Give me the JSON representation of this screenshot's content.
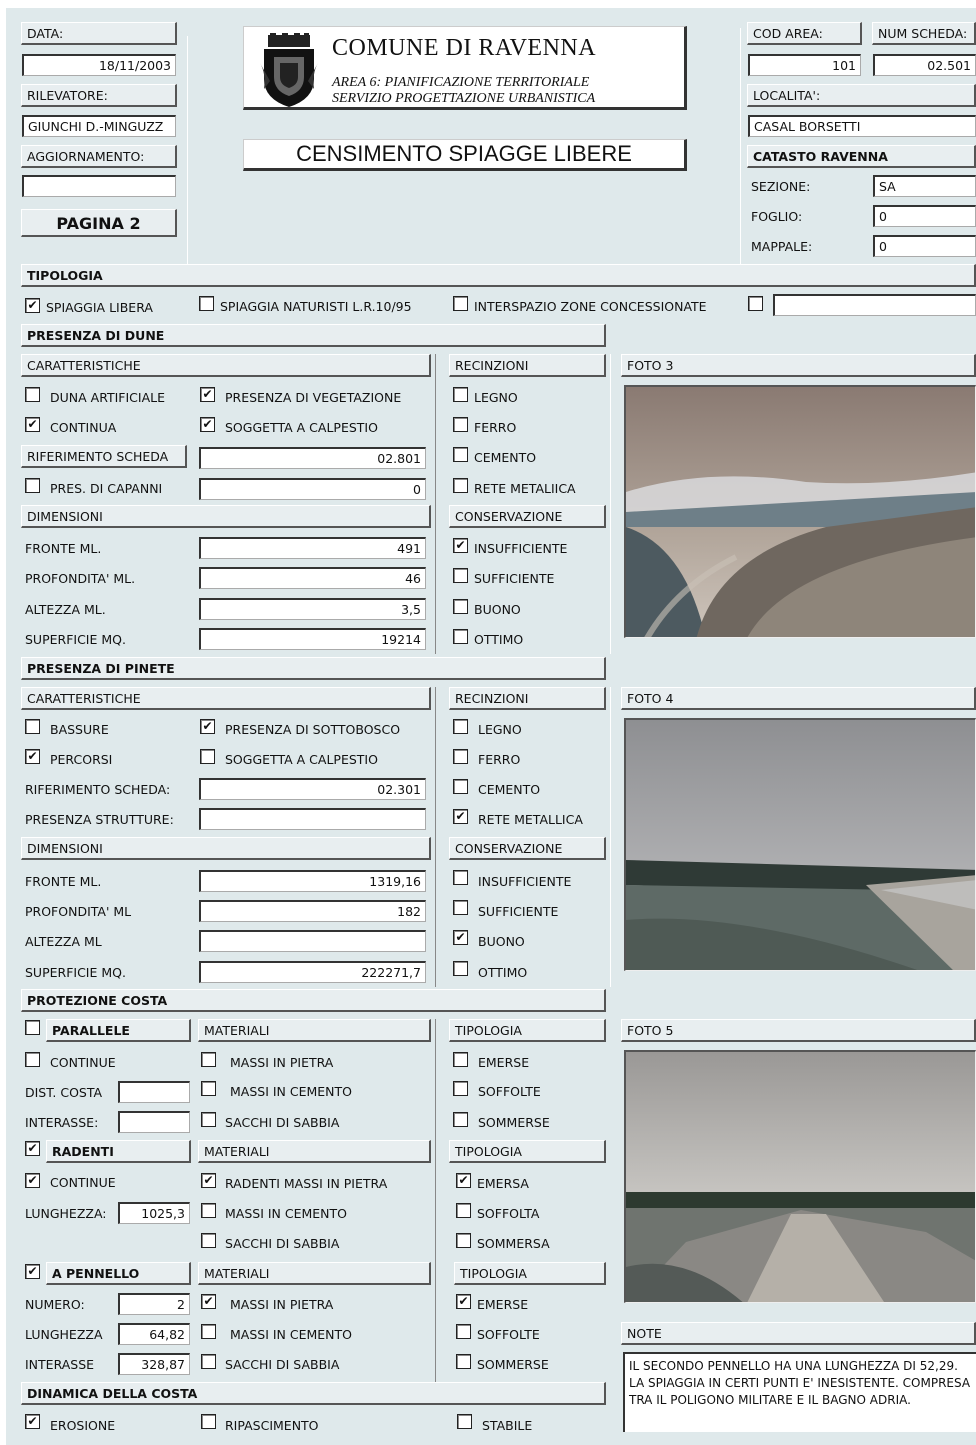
{
  "header": {
    "data_label": "DATA:",
    "data_value": "18/11/2003",
    "rilevatore_label": "RILEVATORE:",
    "rilevatore_value": "GIUNCHI D.-MINGUZZ",
    "aggiornamento_label": "AGGIORNAMENTO:",
    "aggiornamento_value": "",
    "pagina": "PAGINA 2",
    "comune": "COMUNE DI RAVENNA",
    "area_line1": "AREA 6: PIANIFICAZIONE TERRITORIALE",
    "area_line2": "SERVIZIO PROGETTAZIONE URBANISTICA",
    "title": "CENSIMENTO SPIAGGE LIBERE",
    "cod_area_label": "COD AREA:",
    "cod_area_value": "101",
    "num_scheda_label": "NUM SCHEDA:",
    "num_scheda_value": "02.501",
    "localita_label": "LOCALITA':",
    "localita_value": "CASAL BORSETTI",
    "catasto": "CATASTO RAVENNA",
    "sezione_label": "SEZIONE:",
    "sezione_value": "SA",
    "foglio_label": "FOGLIO:",
    "foglio_value": "0",
    "mappale_label": "MAPPALE:",
    "mappale_value": "0"
  },
  "tipologia": {
    "title": "TIPOLOGIA",
    "spiaggia_libera": "SPIAGGIA LIBERA",
    "spiaggia_naturisti": "SPIAGGIA NATURISTI L.R.10/95",
    "interspazio": "INTERSPAZIO ZONE CONCESSIONATE",
    "other_value": ""
  },
  "dune": {
    "title": "PRESENZA DI DUNE",
    "caratteristiche": "CARATTERISTICHE",
    "recinzioni": "RECINZIONI",
    "duna_artificiale": "DUNA ARTIFICIALE",
    "presenza_vegetazione": "PRESENZA DI VEGETAZIONE",
    "continua": "CONTINUA",
    "soggetta_calpestio": "SOGGETTA A CALPESTIO",
    "riferimento_label": "RIFERIMENTO SCHEDA",
    "riferimento_value": "02.801",
    "pres_capanni": "PRES. DI CAPANNI",
    "pres_capanni_value": "0",
    "legno": "LEGNO",
    "ferro": "FERRO",
    "cemento": "CEMENTO",
    "rete": "RETE METALIICA",
    "dimensioni": "DIMENSIONI",
    "conservazione": "CONSERVAZIONE",
    "fronte_label": "FRONTE ML.",
    "fronte_value": "491",
    "profondita_label": "PROFONDITA' ML.",
    "profondita_value": "46",
    "altezza_label": "ALTEZZA ML.",
    "altezza_value": "3,5",
    "superficie_label": "SUPERFICIE MQ.",
    "superficie_value": "19214",
    "insufficiente": "INSUFFICIENTE",
    "sufficiente": "SUFFICIENTE",
    "buono": "BUONO",
    "ottimo": "OTTIMO"
  },
  "pinete": {
    "title": "PRESENZA DI PINETE",
    "caratteristiche": "CARATTERISTICHE",
    "recinzioni": "RECINZIONI",
    "bassure": "BASSURE",
    "presenza_sottobosco": "PRESENZA DI SOTTOBOSCO",
    "percorsi": "PERCORSI",
    "soggetta_calpestio": "SOGGETTA A CALPESTIO",
    "riferimento_label": "RIFERIMENTO SCHEDA:",
    "riferimento_value": "02.301",
    "strutture_label": "PRESENZA STRUTTURE:",
    "strutture_value": "",
    "legno": "LEGNO",
    "ferro": "FERRO",
    "cemento": "CEMENTO",
    "rete": "RETE METALLICA",
    "dimensioni": "DIMENSIONI",
    "conservazione": "CONSERVAZIONE",
    "fronte_label": "FRONTE ML.",
    "fronte_value": "1319,16",
    "profondita_label": "PROFONDITA' ML",
    "profondita_value": "182",
    "altezza_label": "ALTEZZA ML",
    "altezza_value": "",
    "superficie_label": "SUPERFICIE MQ.",
    "superficie_value": "222271,7",
    "insufficiente": "INSUFFICIENTE",
    "sufficiente": "SUFFICIENTE",
    "buono": "BUONO",
    "ottimo": "OTTIMO"
  },
  "protezione": {
    "title": "PROTEZIONE COSTA",
    "parallele": "PARALLELE",
    "materiali": "MATERIALI",
    "tipologia": "TIPOLOGIA",
    "continue": "CONTINUE",
    "dist_costa": "DIST. COSTA",
    "dist_costa_value": "",
    "interasse": "INTERASSE:",
    "interasse_value": "",
    "massi_pietra": "MASSI IN PIETRA",
    "massi_cemento": "MASSI IN CEMENTO",
    "sacchi_sabbia": "SACCHI DI SABBIA",
    "emerse": "EMERSE",
    "soffolte": "SOFFOLTE",
    "sommerse": "SOMMERSE",
    "radenti": "RADENTI",
    "lunghezza": "LUNGHEZZA:",
    "radenti_lunghezza_value": "1025,3",
    "radenti_massi_pietra": "RADENTI MASSI IN PIETRA",
    "emersa": "EMERSA",
    "soffolta": "SOFFOLTA",
    "sommersa": "SOMMERSA",
    "a_pennello": "A PENNELLO",
    "numero": "NUMERO:",
    "numero_value": "2",
    "lunghezza2": "LUNGHEZZA",
    "pennello_lunghezza_value": "64,82",
    "interasse2": "INTERASSE",
    "pennello_interasse_value": "328,87"
  },
  "dinamica": {
    "title": "DINAMICA DELLA COSTA",
    "erosione": "EROSIONE",
    "ripascimento": "RIPASCIMENTO",
    "stabile": "STABILE"
  },
  "foto": {
    "foto3": "FOTO 3",
    "foto4": "FOTO 4",
    "foto5": "FOTO 5"
  },
  "note": {
    "label": "NOTE",
    "text": "IL SECONDO PENNELLO HA UNA LUNGHEZZA DI 52,29. LA SPIAGGIA IN CERTI PUNTI E' INESISTENTE. COMPRESA TRA IL POLIGONO MILITARE E IL BAGNO ADRIA."
  },
  "checkboxes": {
    "spiaggia_libera": true,
    "spiaggia_naturisti": false,
    "interspazio": false,
    "other": false,
    "dune_duna_artificiale": false,
    "dune_presenza_vegetazione": true,
    "dune_continua": true,
    "dune_soggetta_calpestio": true,
    "dune_pres_capanni": false,
    "dune_legno": false,
    "dune_ferro": false,
    "dune_cemento": false,
    "dune_rete": false,
    "dune_insufficiente": true,
    "dune_sufficiente": false,
    "dune_buono": false,
    "dune_ottimo": false,
    "pin_bassure": false,
    "pin_sottobosco": true,
    "pin_percorsi": true,
    "pin_calpestio": false,
    "pin_legno": false,
    "pin_ferro": false,
    "pin_cemento": false,
    "pin_rete": true,
    "pin_insufficiente": false,
    "pin_sufficiente": false,
    "pin_buono": true,
    "pin_ottimo": false,
    "par_parallele": false,
    "par_continue": false,
    "par_massi_pietra": false,
    "par_massi_cemento": false,
    "par_sacchi": false,
    "par_emerse": false,
    "par_soffolte": false,
    "par_sommerse": false,
    "rad_radenti": true,
    "rad_continue": true,
    "rad_massi_pietra": true,
    "rad_massi_cemento": false,
    "rad_sacchi": false,
    "rad_emersa": true,
    "rad_soffolta": false,
    "rad_sommersa": false,
    "pen_pennello": true,
    "pen_massi_pietra": true,
    "pen_massi_cemento": false,
    "pen_sacchi": false,
    "pen_emerse": true,
    "pen_soffolte": false,
    "pen_sommerse": false,
    "din_erosione": true,
    "din_ripascimento": false,
    "din_stabile": false
  }
}
